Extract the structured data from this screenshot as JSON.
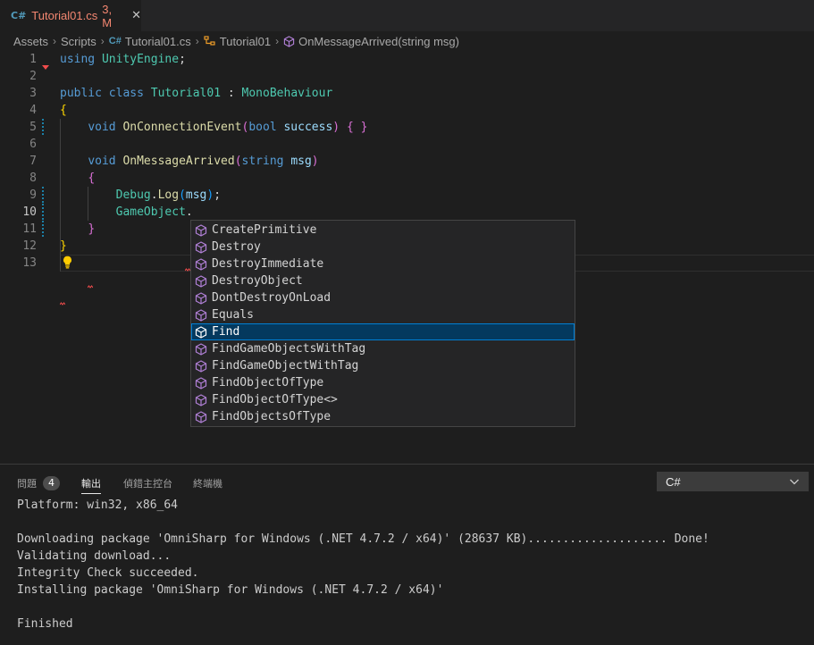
{
  "tab": {
    "icon": "csharp-file-icon",
    "icon_glyph": "C#",
    "title": "Tutorial01.cs",
    "badge": "3, M",
    "close_glyph": "✕"
  },
  "breadcrumb": {
    "items": [
      "Assets",
      "Scripts",
      "Tutorial01.cs",
      "Tutorial01",
      "OnMessageArrived(string msg)"
    ],
    "separator": "›",
    "cs_icon_glyph": "C#"
  },
  "editor": {
    "line_numbers": [
      "1",
      "2",
      "3",
      "4",
      "5",
      "6",
      "7",
      "8",
      "9",
      "10",
      "11",
      "12",
      "13"
    ],
    "active_line": "10",
    "lines": [
      [
        {
          "t": "using ",
          "c": "kw"
        },
        {
          "t": "UnityEngine",
          "c": "ty"
        },
        {
          "t": ";",
          "c": "pl"
        }
      ],
      [],
      [
        {
          "t": "public ",
          "c": "kw"
        },
        {
          "t": "class ",
          "c": "kw"
        },
        {
          "t": "Tutorial01",
          "c": "ty"
        },
        {
          "t": " : ",
          "c": "pl"
        },
        {
          "t": "MonoBehaviour",
          "c": "ty"
        }
      ],
      [
        {
          "t": "{",
          "c": "b1"
        }
      ],
      [
        {
          "t": "    ",
          "c": "pl"
        },
        {
          "t": "void ",
          "c": "kw"
        },
        {
          "t": "OnConnectionEvent",
          "c": "fn"
        },
        {
          "t": "(",
          "c": "b2"
        },
        {
          "t": "bool ",
          "c": "kw"
        },
        {
          "t": "success",
          "c": "pm"
        },
        {
          "t": ")",
          "c": "b2"
        },
        {
          "t": " ",
          "c": "pl"
        },
        {
          "t": "{ }",
          "c": "b2"
        }
      ],
      [],
      [
        {
          "t": "    ",
          "c": "pl"
        },
        {
          "t": "void ",
          "c": "kw"
        },
        {
          "t": "OnMessageArrived",
          "c": "fn"
        },
        {
          "t": "(",
          "c": "b2"
        },
        {
          "t": "string ",
          "c": "kw"
        },
        {
          "t": "msg",
          "c": "pm"
        },
        {
          "t": ")",
          "c": "b2"
        }
      ],
      [
        {
          "t": "    ",
          "c": "pl"
        },
        {
          "t": "{",
          "c": "b2"
        }
      ],
      [
        {
          "t": "        ",
          "c": "pl"
        },
        {
          "t": "Debug",
          "c": "ty"
        },
        {
          "t": ".",
          "c": "pl"
        },
        {
          "t": "Log",
          "c": "fn"
        },
        {
          "t": "(",
          "c": "b3"
        },
        {
          "t": "msg",
          "c": "pm"
        },
        {
          "t": ")",
          "c": "b3"
        },
        {
          "t": ";",
          "c": "pl"
        }
      ],
      [
        {
          "t": "        ",
          "c": "pl"
        },
        {
          "t": "GameObject",
          "c": "ty"
        },
        {
          "t": ".",
          "c": "pl"
        }
      ],
      [
        {
          "t": "    ",
          "c": "pl"
        },
        {
          "t": "}",
          "c": "b2"
        }
      ],
      [
        {
          "t": "}",
          "c": "b1"
        }
      ],
      []
    ]
  },
  "suggestions": {
    "typed": "",
    "items": [
      {
        "label": "CreatePrimitive"
      },
      {
        "label": "Destroy"
      },
      {
        "label": "DestroyImmediate"
      },
      {
        "label": "DestroyObject"
      },
      {
        "label": "DontDestroyOnLoad"
      },
      {
        "label": "Equals"
      },
      {
        "label": "Find",
        "selected": true
      },
      {
        "label": "FindGameObjectsWithTag"
      },
      {
        "label": "FindGameObjectWithTag"
      },
      {
        "label": "FindObjectOfType"
      },
      {
        "label": "FindObjectOfType<>"
      },
      {
        "label": "FindObjectsOfType"
      }
    ]
  },
  "panel": {
    "tabs": [
      {
        "label": "問題",
        "count": "4"
      },
      {
        "label": "輸出",
        "active": true
      },
      {
        "label": "偵錯主控台"
      },
      {
        "label": "終端機"
      }
    ],
    "dropdown_value": "C#",
    "output_lines": [
      "Platform: win32, x86_64",
      "",
      "Downloading package 'OmniSharp for Windows (.NET 4.7.2 / x64)' (28637 KB).................... Done!",
      "Validating download...",
      "Integrity Check succeeded.",
      "Installing package 'OmniSharp for Windows (.NET 4.7.2 / x64)'",
      "",
      "Finished"
    ]
  },
  "colors": {
    "accent": "#007fd4",
    "selection": "#04395e",
    "error": "#f14c4c",
    "modified": "#1b81a8",
    "method_icon": "#b180d7"
  }
}
